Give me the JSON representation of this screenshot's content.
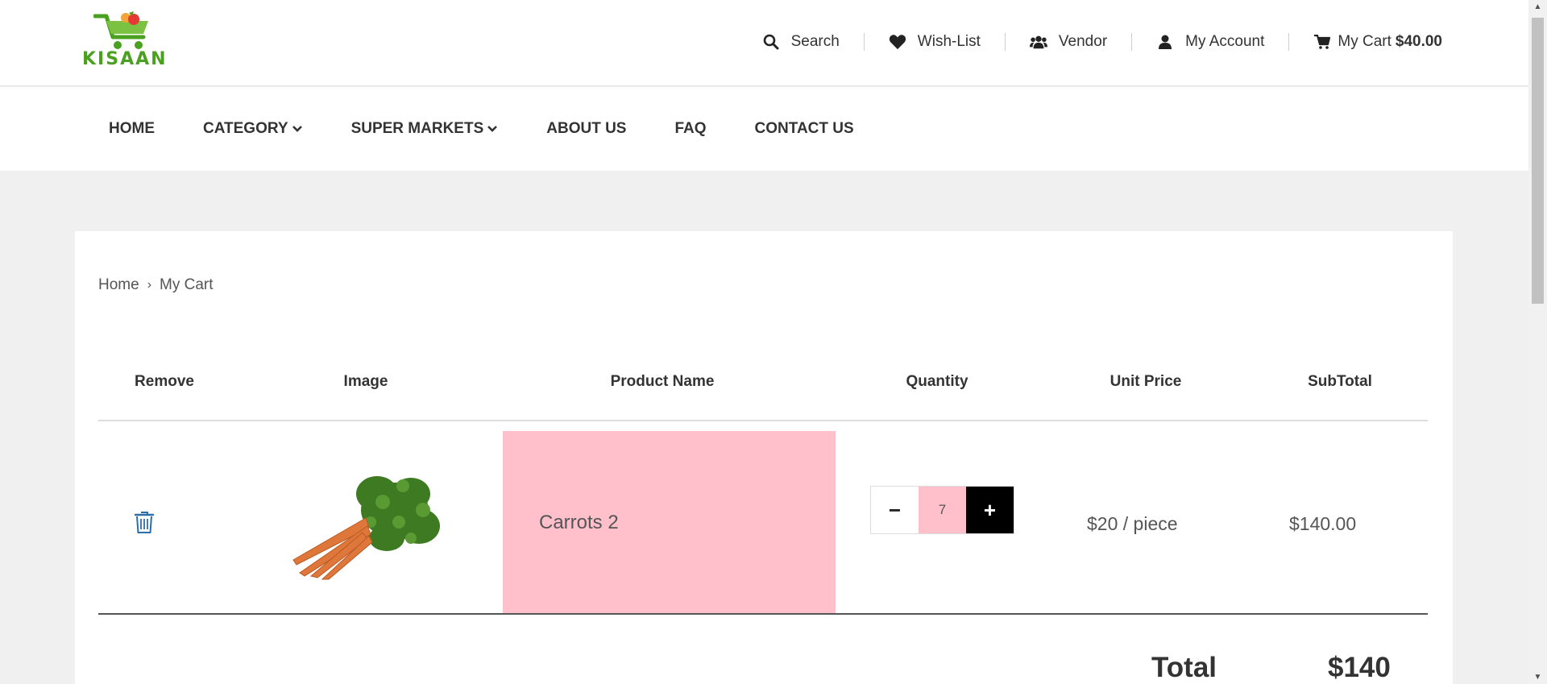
{
  "brand": {
    "logo_text": "KISAAN",
    "accent": "#4aa120"
  },
  "top_links": {
    "search": "Search",
    "wishlist": "Wish-List",
    "vendor": "Vendor",
    "account": "My Account",
    "cart": "My Cart",
    "cart_total": "$40.00"
  },
  "nav": {
    "home": "HOME",
    "category": "CATEGORY",
    "super_markets": "SUPER MARKETS",
    "about": "ABOUT US",
    "faq": "FAQ",
    "contact": "CONTACT US"
  },
  "breadcrumb": {
    "home": "Home",
    "current": "My Cart"
  },
  "table": {
    "headers": [
      "Remove",
      "Image",
      "Product Name",
      "Quantity",
      "Unit Price",
      "SubTotal"
    ],
    "rows": [
      {
        "name": "Carrots 2",
        "quantity": "7",
        "unit_price": "$20 / piece",
        "subtotal": "$140.00"
      }
    ]
  },
  "qty_controls": {
    "minus": "−",
    "plus": "+"
  },
  "totals": {
    "label": "Total",
    "value": "$140"
  },
  "colors": {
    "highlight": "#ffc0cb",
    "link_blue": "#2c6fa8"
  }
}
